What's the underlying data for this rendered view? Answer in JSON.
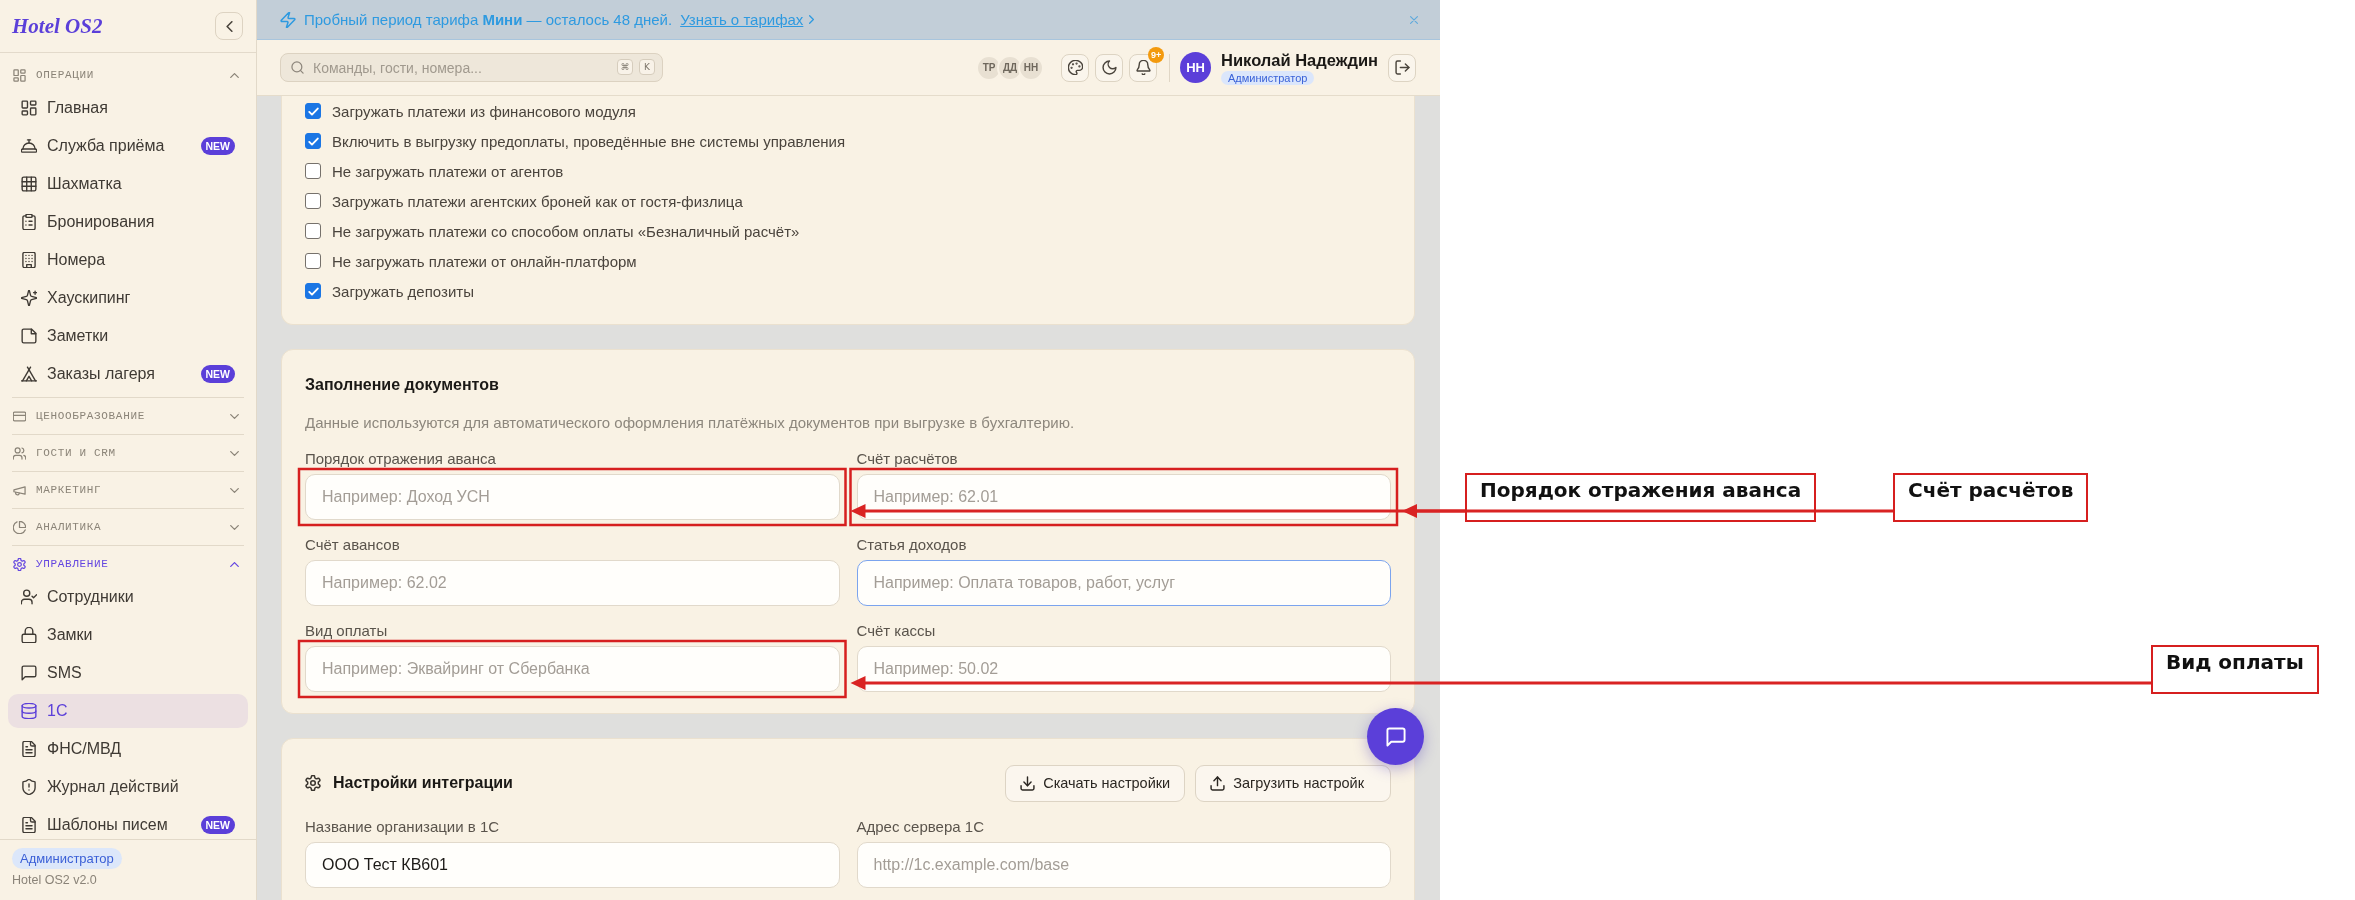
{
  "sidebar": {
    "logo": "Hotel OS2",
    "sections": [
      {
        "title": "ОПЕРАЦИИ",
        "expanded": true,
        "items": [
          {
            "label": "Главная",
            "selected": false
          },
          {
            "label": "Служба приёма",
            "selected": false,
            "badge": "NEW"
          },
          {
            "label": "Шахматка",
            "selected": false
          },
          {
            "label": "Бронирования",
            "selected": false
          },
          {
            "label": "Номера",
            "selected": false
          },
          {
            "label": "Хаускипинг",
            "selected": false
          },
          {
            "label": "Заметки",
            "selected": false
          },
          {
            "label": "Заказы лагеря",
            "selected": false,
            "badge": "NEW"
          }
        ]
      },
      {
        "title": "ЦЕНООБРАЗОВАНИЕ",
        "expanded": false
      },
      {
        "title": "ГОСТИ И CRM",
        "expanded": false
      },
      {
        "title": "МАРКЕТИНГ",
        "expanded": false
      },
      {
        "title": "АНАЛИТИКА",
        "expanded": false
      },
      {
        "title": "УПРАВЛЕНИЕ",
        "expanded": true,
        "items": [
          {
            "label": "Сотрудники",
            "selected": false
          },
          {
            "label": "Замки",
            "selected": false
          },
          {
            "label": "SMS",
            "selected": false
          },
          {
            "label": "1С",
            "selected": true
          },
          {
            "label": "ФНС/МВД",
            "selected": false
          },
          {
            "label": "Журнал действий",
            "selected": false
          },
          {
            "label": "Шаблоны писем",
            "selected": false,
            "badge": "NEW"
          }
        ]
      }
    ],
    "footer": {
      "role": "Администратор",
      "version": "Hotel OS2 v2.0"
    }
  },
  "banner": {
    "text": "Пробный период тарифа **Мини** — осталось 48 дней.",
    "link": "Узнать о тарифах"
  },
  "header": {
    "search": {
      "placeholder": "Команды, гости, номера...",
      "shortcut": [
        "⌘",
        "K"
      ]
    },
    "online_users": [
      "ТР",
      "ДД",
      "НН"
    ],
    "notifications_badge": "9+",
    "user": {
      "initials": "НН",
      "name": "Николай Надеждин",
      "role": "Администратор"
    }
  },
  "payment_options": {
    "options": [
      {
        "label": "Загружать платежи из финансового модуля",
        "checked": true
      },
      {
        "label": "Включить в выгрузку предоплаты, проведённые вне системы управления",
        "checked": true
      },
      {
        "label": "Не загружать платежи от агентов",
        "checked": false
      },
      {
        "label": "Загружать платежи агентских броней как от гостя-физлица",
        "checked": false
      },
      {
        "label": "Не загружать платежи со способом оплаты «Безналичный расчёт»",
        "checked": false
      },
      {
        "label": "Не загружать платежи от онлайн-платформ",
        "checked": false
      },
      {
        "label": "Загружать депозиты",
        "checked": true
      }
    ]
  },
  "documents": {
    "title": "Заполнение документов",
    "description": "Данные используются для автоматического оформления платёжных документов при выгрузке в бухгалтерию.",
    "fields": [
      {
        "label": "Порядок отражения аванса",
        "placeholder": "Например: Доход УСН",
        "focused": false,
        "callout": "Порядок отражения аванса"
      },
      {
        "label": "Счёт расчётов",
        "placeholder": "Например: 62.01",
        "focused": false,
        "callout": "Счёт расчётов"
      },
      {
        "label": "Счёт авансов",
        "placeholder": "Например: 62.02",
        "focused": false
      },
      {
        "label": "Статья доходов",
        "placeholder": "Например: Оплата товаров, работ, услуг",
        "focused": true
      },
      {
        "label": "Вид оплаты",
        "placeholder": "Например: Эквайринг от Сбербанка",
        "focused": false,
        "callout": "Вид оплаты"
      },
      {
        "label": "Счёт кассы",
        "placeholder": "Например: 50.02",
        "focused": false
      }
    ]
  },
  "integration": {
    "title": "Настройки интеграции",
    "buttons": [
      "Скачать настройки",
      "Загрузить настройк"
    ],
    "fields": [
      {
        "label": "Название организации в 1С",
        "value": "ООО Тест КВ601"
      },
      {
        "label": "Адрес сервера 1С",
        "placeholder": "http://1c.example.com/base"
      }
    ]
  }
}
